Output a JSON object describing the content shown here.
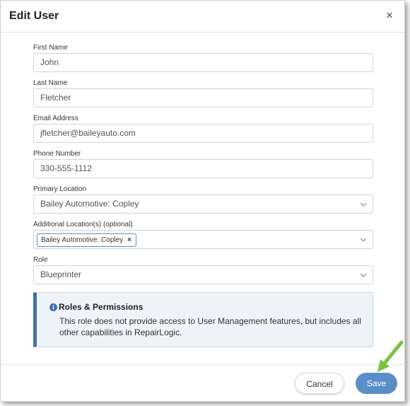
{
  "modal": {
    "title": "Edit User",
    "close_label": "×"
  },
  "fields": {
    "first_name": {
      "label": "First Name",
      "value": "John"
    },
    "last_name": {
      "label": "Last Name",
      "value": "Fletcher"
    },
    "email": {
      "label": "Email Address",
      "value": "jfletcher@baileyauto.com"
    },
    "phone": {
      "label": "Phone Number",
      "value": "330-555-1112"
    },
    "primary_location": {
      "label": "Primary Location",
      "value": "Bailey Automotive: Copley"
    },
    "additional_locations": {
      "label": "Additional Location(s) (optional)",
      "chips": [
        "Bailey Automotive: Copley"
      ],
      "chip_remove": "×"
    },
    "role": {
      "label": "Role",
      "value": "Blueprinter"
    }
  },
  "info": {
    "title": "Roles & Permissions",
    "body": "This role does not provide access to User Management features, but includes all other capabilities in RepairLogic.",
    "icon": "info-icon",
    "accent": "#3f6fa8"
  },
  "footer": {
    "cancel_label": "Cancel",
    "save_label": "Save"
  },
  "colors": {
    "primary": "#5b8ec9",
    "annotation_arrow": "#7ac143"
  }
}
